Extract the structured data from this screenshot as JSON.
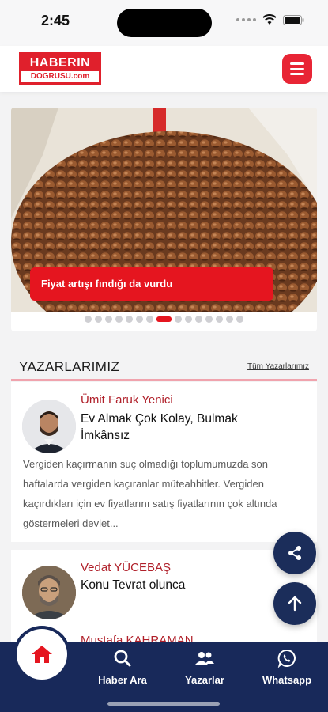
{
  "status_bar": {
    "time": "2:45"
  },
  "header": {
    "logo_line1": "HABERIN",
    "logo_line2": "DOGRUSU.com",
    "brand_color": "#e0202c"
  },
  "slider": {
    "caption": "Fiyat artışı fındığı da vurdu",
    "dot_count": 15,
    "active_index": 7
  },
  "authors_section": {
    "title": "YAZARLARIMIZ",
    "all_link": "Tüm Yazarlarımız",
    "authors": [
      {
        "name": "Ümit Faruk Yenici",
        "title": "Ev Almak Çok Kolay, Bulmak İmkânsız",
        "excerpt": "Vergiden kaçırmanın suç olmadığı toplumumuzda son haftalarda vergiden kaçıranlar müteahhitler. Vergiden kaçırdıkları için ev fiyatlarını satış fiyatlarının çok altında göstermeleri devlet..."
      },
      {
        "name": "Vedat YÜCEBAŞ",
        "title": "Konu Tevrat olunca"
      },
      {
        "name": "Mustafa KAHRAMAN"
      }
    ]
  },
  "bottom_nav": {
    "items": [
      {
        "label": "Haber Ara",
        "icon": "search-icon"
      },
      {
        "label": "Yazarlar",
        "icon": "users-icon"
      },
      {
        "label": "Whatsapp",
        "icon": "whatsapp-icon"
      }
    ],
    "home_icon": "home-icon",
    "nav_color": "#18295a",
    "accent_color": "#e5151f"
  }
}
